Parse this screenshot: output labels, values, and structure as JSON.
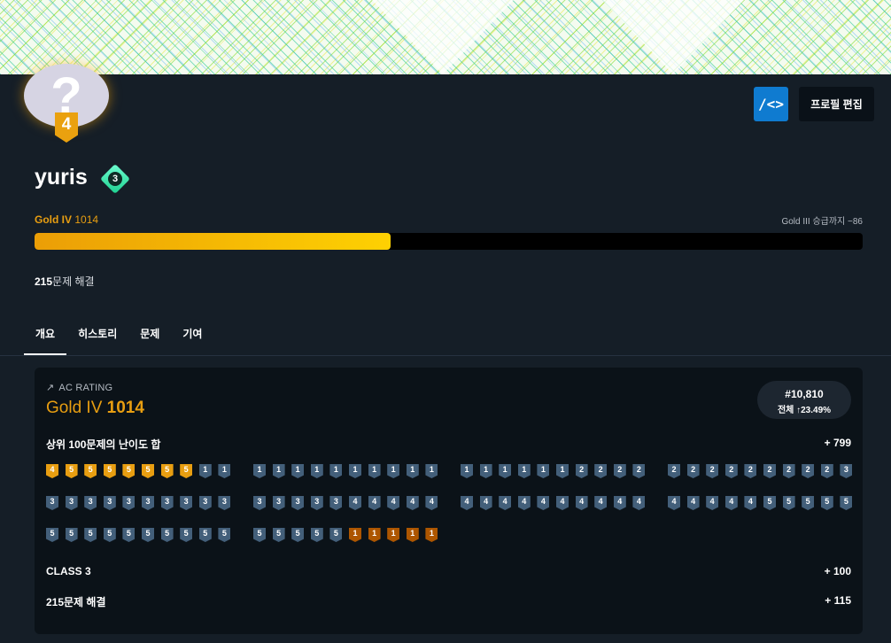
{
  "profile": {
    "avatar_glyph": "?",
    "avatar_tier": "4",
    "username": "yuris",
    "class_number": "3",
    "tier_name": "Gold IV",
    "rating": "1014",
    "next_tier_text": "Gold III 승급까지 −86",
    "progress_fraction": 0.43,
    "solved_count": "215",
    "solved_suffix": "문제 해결"
  },
  "header_buttons": {
    "code_icon_glyph": "/<>",
    "edit_label": "프로필 편집"
  },
  "tabs": [
    {
      "label": "개요",
      "active": true
    },
    {
      "label": "히스토리",
      "active": false
    },
    {
      "label": "문제",
      "active": false
    },
    {
      "label": "기여",
      "active": false
    }
  ],
  "rating_card": {
    "icon_glyph": "↗",
    "label": "AC RATING",
    "tier_name": "Gold IV",
    "rating": "1014",
    "rank": "#10,810",
    "rank_detail": "전체 ↑23.49%",
    "top100_label": "상위 100문제의 난이도 합",
    "top100_value": "+ 799",
    "class_label": "CLASS 3",
    "class_value": "+ 100",
    "solved_label": "215문제 해결",
    "solved_value": "+ 115"
  },
  "tier_grid": [
    [
      "g4",
      "g5",
      "g5",
      "g5",
      "g5",
      "g5",
      "g5",
      "g5",
      "s1",
      "s1",
      "s1",
      "s1",
      "s1",
      "s1",
      "s1",
      "s1",
      "s1",
      "s1",
      "s1",
      "s1",
      "s1",
      "s1",
      "s1",
      "s1",
      "s1",
      "s1",
      "s2",
      "s2",
      "s2",
      "s2",
      "s2",
      "s2",
      "s2",
      "s2",
      "s2",
      "s2",
      "s2",
      "s2",
      "s2",
      "s3"
    ],
    [
      "s3",
      "s3",
      "s3",
      "s3",
      "s3",
      "s3",
      "s3",
      "s3",
      "s3",
      "s3",
      "s3",
      "s3",
      "s3",
      "s3",
      "s3",
      "s4",
      "s4",
      "s4",
      "s4",
      "s4",
      "s4",
      "s4",
      "s4",
      "s4",
      "s4",
      "s4",
      "s4",
      "s4",
      "s4",
      "s4",
      "s4",
      "s4",
      "s4",
      "s4",
      "s4",
      "s5",
      "s5",
      "s5",
      "s5",
      "s5"
    ],
    [
      "s5",
      "s5",
      "s5",
      "s5",
      "s5",
      "s5",
      "s5",
      "s5",
      "s5",
      "s5",
      "s5",
      "s5",
      "s5",
      "s5",
      "s5",
      "b1",
      "b1",
      "b1",
      "b1",
      "b1"
    ]
  ],
  "colors": {
    "background": "#151e27",
    "card": "#0b1218",
    "gold": "#e89e11",
    "silver": "#435f7a",
    "bronze": "#ad5600",
    "accent_blue": "#0f7bd0",
    "progress_start": "#eb9e06",
    "progress_end": "#fed102"
  }
}
